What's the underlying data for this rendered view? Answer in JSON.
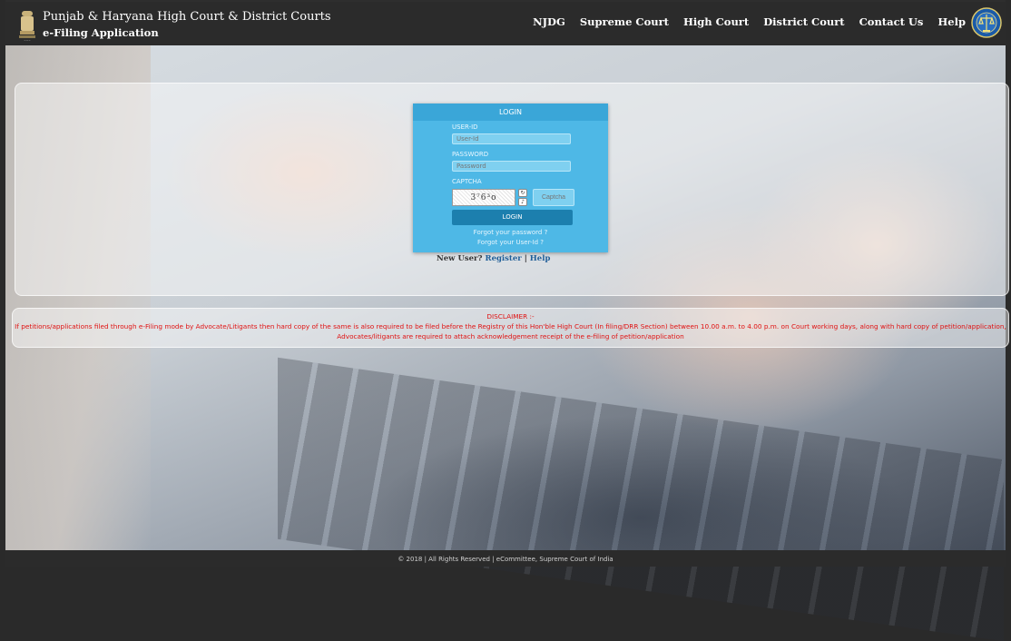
{
  "header": {
    "title_line1": "Punjab & Haryana High Court & District Courts",
    "title_line2": "e-Filing Application",
    "nav": [
      "NJDG",
      "Supreme Court",
      "High Court",
      "District Court",
      "Contact Us",
      "Help"
    ]
  },
  "login": {
    "heading": "LOGIN",
    "userid_label": "USER-ID",
    "userid_placeholder": "User-Id",
    "password_label": "PASSWORD",
    "password_placeholder": "Password",
    "captcha_label": "CAPTCHA",
    "captcha_text": "3⁷6³o",
    "captcha_placeholder": "Captcha",
    "login_button": "LOGIN",
    "forgot_password": "Forgot your password ?",
    "forgot_userid": "Forgot your User-Id ?"
  },
  "register": {
    "prompt": "New User?",
    "register_link": "Register",
    "separator": "|",
    "help_link": "Help"
  },
  "disclaimer": {
    "title": "DISCLAIMER :-",
    "text": "If petitions/applications filed through e-Filing mode by Advocate/Litigants then hard copy of the same is also required to be filed before the Registry of this Hon'ble High Court (In filing/DRR Section) between 10.00 a.m. to 4.00 p.m. on Court working days, along with hard copy of petition/application, Advocates/litigants are required to attach acknowledgement receipt of the e-filing of petition/application"
  },
  "footer": {
    "text": "© 2018 | All Rights Reserved | eCommittee, Supreme Court of India"
  },
  "colors": {
    "header_bg": "#2b2b2b",
    "login_bg": "#4eb8e6",
    "login_button": "#1c7fae",
    "disclaimer_text": "#e01212"
  },
  "icons": {
    "emblem": "national-emblem-icon",
    "court_logo": "high-court-logo-icon",
    "refresh": "refresh-icon",
    "audio": "audio-icon"
  }
}
